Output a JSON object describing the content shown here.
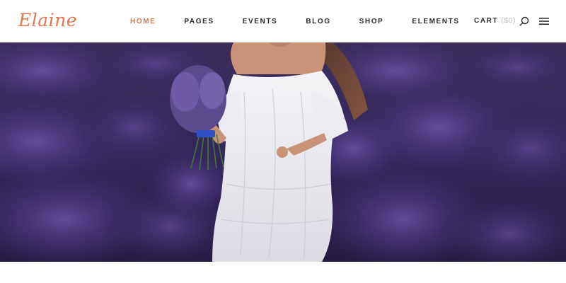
{
  "brand": {
    "logo_text": "Elaine",
    "accent_color": "#e0774f"
  },
  "nav": {
    "items": [
      {
        "label": "HOME",
        "active": true
      },
      {
        "label": "PAGES",
        "active": false
      },
      {
        "label": "EVENTS",
        "active": false
      },
      {
        "label": "BLOG",
        "active": false
      },
      {
        "label": "SHOP",
        "active": false
      },
      {
        "label": "ELEMENTS",
        "active": false
      }
    ]
  },
  "cart": {
    "label": "CART",
    "amount": "($0)"
  },
  "icons": {
    "search": "search-icon",
    "menu": "hamburger-menu-icon"
  }
}
